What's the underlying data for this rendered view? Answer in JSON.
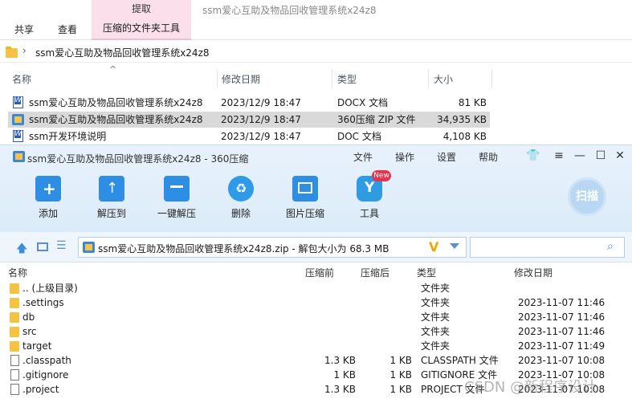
{
  "ribbon": {
    "extract_header": "提取",
    "tabs": [
      "共享",
      "查看"
    ],
    "zip_tools": "压缩的文件夹工具",
    "window_title": "ssm爱心互助及物品回收管理系统x24z8"
  },
  "address": {
    "path": "ssm爱心互助及物品回收管理系统x24z8"
  },
  "explorer": {
    "headers": [
      "名称",
      "修改日期",
      "类型",
      "大小"
    ],
    "rows": [
      {
        "name": "ssm爱心互助及物品回收管理系统x24z8",
        "date": "2023/12/9 18:47",
        "type": "DOCX 文档",
        "size": "81 KB",
        "icon": "word-icon"
      },
      {
        "name": "ssm爱心互助及物品回收管理系统x24z8",
        "date": "2023/12/9 18:47",
        "type": "360压缩 ZIP 文件",
        "size": "34,935 KB",
        "icon": "zip-icon"
      },
      {
        "name": "ssm开发环境说明",
        "date": "2023/12/9 18:47",
        "type": "DOC 文档",
        "size": "4,108 KB",
        "icon": "word-icon"
      }
    ]
  },
  "zip": {
    "title": "ssm爱心互助及物品回收管理系统x24z8 - 360压缩",
    "menu": [
      "文件",
      "操作",
      "设置",
      "帮助"
    ],
    "tools": [
      "添加",
      "解压到",
      "一键解压",
      "删除",
      "图片压缩",
      "工具"
    ],
    "new_badge": "New",
    "scan": "扫描",
    "path": "ssm爱心互助及物品回收管理系统x24z8.zip - 解包大小为 68.3 MB",
    "headers": [
      "名称",
      "压缩前",
      "压缩后",
      "类型",
      "修改日期"
    ],
    "rows": [
      {
        "name": ".. (上级目录)",
        "before": "",
        "after": "",
        "type": "文件夹",
        "date": "",
        "kind": "folder"
      },
      {
        "name": ".settings",
        "before": "",
        "after": "",
        "type": "文件夹",
        "date": "2023-11-07 11:46",
        "kind": "folder"
      },
      {
        "name": "db",
        "before": "",
        "after": "",
        "type": "文件夹",
        "date": "2023-11-07 11:46",
        "kind": "folder"
      },
      {
        "name": "src",
        "before": "",
        "after": "",
        "type": "文件夹",
        "date": "2023-11-07 11:46",
        "kind": "folder"
      },
      {
        "name": "target",
        "before": "",
        "after": "",
        "type": "文件夹",
        "date": "2023-11-07 11:49",
        "kind": "folder"
      },
      {
        "name": ".classpath",
        "before": "1.3 KB",
        "after": "1 KB",
        "type": "CLASSPATH 文件",
        "date": "2023-11-07 10:08",
        "kind": "file"
      },
      {
        "name": ".gitignore",
        "before": "1 KB",
        "after": "1 KB",
        "type": "GITIGNORE 文件",
        "date": "2023-11-07 10:08",
        "kind": "file"
      },
      {
        "name": ".project",
        "before": "1.3 KB",
        "after": "1 KB",
        "type": "PROJECT 文件",
        "date": "2023-11-07 10:08",
        "kind": "file"
      }
    ]
  },
  "watermark": "CSDN @新程序设计"
}
